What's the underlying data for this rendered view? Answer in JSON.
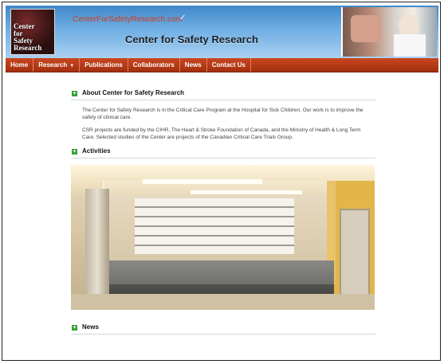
{
  "header": {
    "logo_lines": [
      "Center",
      "for",
      "Safety",
      "Research"
    ],
    "url_text": "CenterForSafetyResearch.com",
    "title": "Center for Safety Research"
  },
  "nav": {
    "items": [
      {
        "label": "Home"
      },
      {
        "label": "Research",
        "has_dropdown": true
      },
      {
        "label": "Publications"
      },
      {
        "label": "Collaborators"
      },
      {
        "label": "News"
      },
      {
        "label": "Contact Us"
      }
    ]
  },
  "sections": {
    "about": {
      "title": "About Center for Safety Research",
      "paragraphs": [
        "The Center for Safety Research is in the Critical Care Program at the Hospital for Sick Children. Our work is to improve the safety of clinical care.",
        "CSR projects are funded by the CIHR, The Heart & Stroke Foundation of Canada, and the Ministry of Health & Long Term Care. Selected studies of the Center are projects of the Canadian Critical Care Trials Group."
      ]
    },
    "activities": {
      "title": "Activities"
    },
    "news": {
      "title": "News"
    }
  },
  "colors": {
    "nav_bg": "#b83a17",
    "section_icon": "#3a9d3a",
    "url_text": "#d13b1d"
  },
  "icons": {
    "section_marker": "plus-square-icon",
    "dropdown": "caret-down-icon"
  }
}
